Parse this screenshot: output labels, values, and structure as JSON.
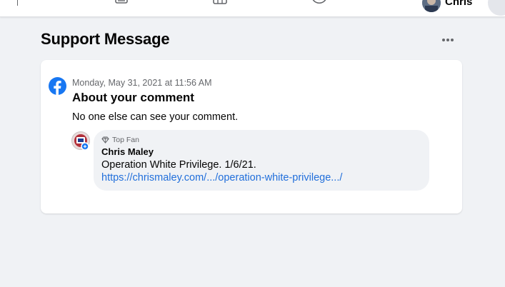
{
  "topbar": {
    "profile_name": "Chris",
    "icons": [
      "home-icon",
      "watch-icon",
      "groups-icon"
    ]
  },
  "page": {
    "title": "Support Message"
  },
  "message": {
    "timestamp": "Monday, May 31, 2021 at 11:56 AM",
    "subject": "About your comment",
    "body": "No one else can see your comment."
  },
  "comment": {
    "badge": "Top Fan",
    "author": "Chris Maley",
    "text": "Operation White Privilege. 1/6/21.",
    "link": "https://chrismaley.com/.../operation-white-privilege.../"
  },
  "colors": {
    "background": "#f0f2f5",
    "card": "#ffffff",
    "facebook_blue": "#1877f2",
    "link": "#216fdb",
    "secondary_text": "#65676b"
  }
}
